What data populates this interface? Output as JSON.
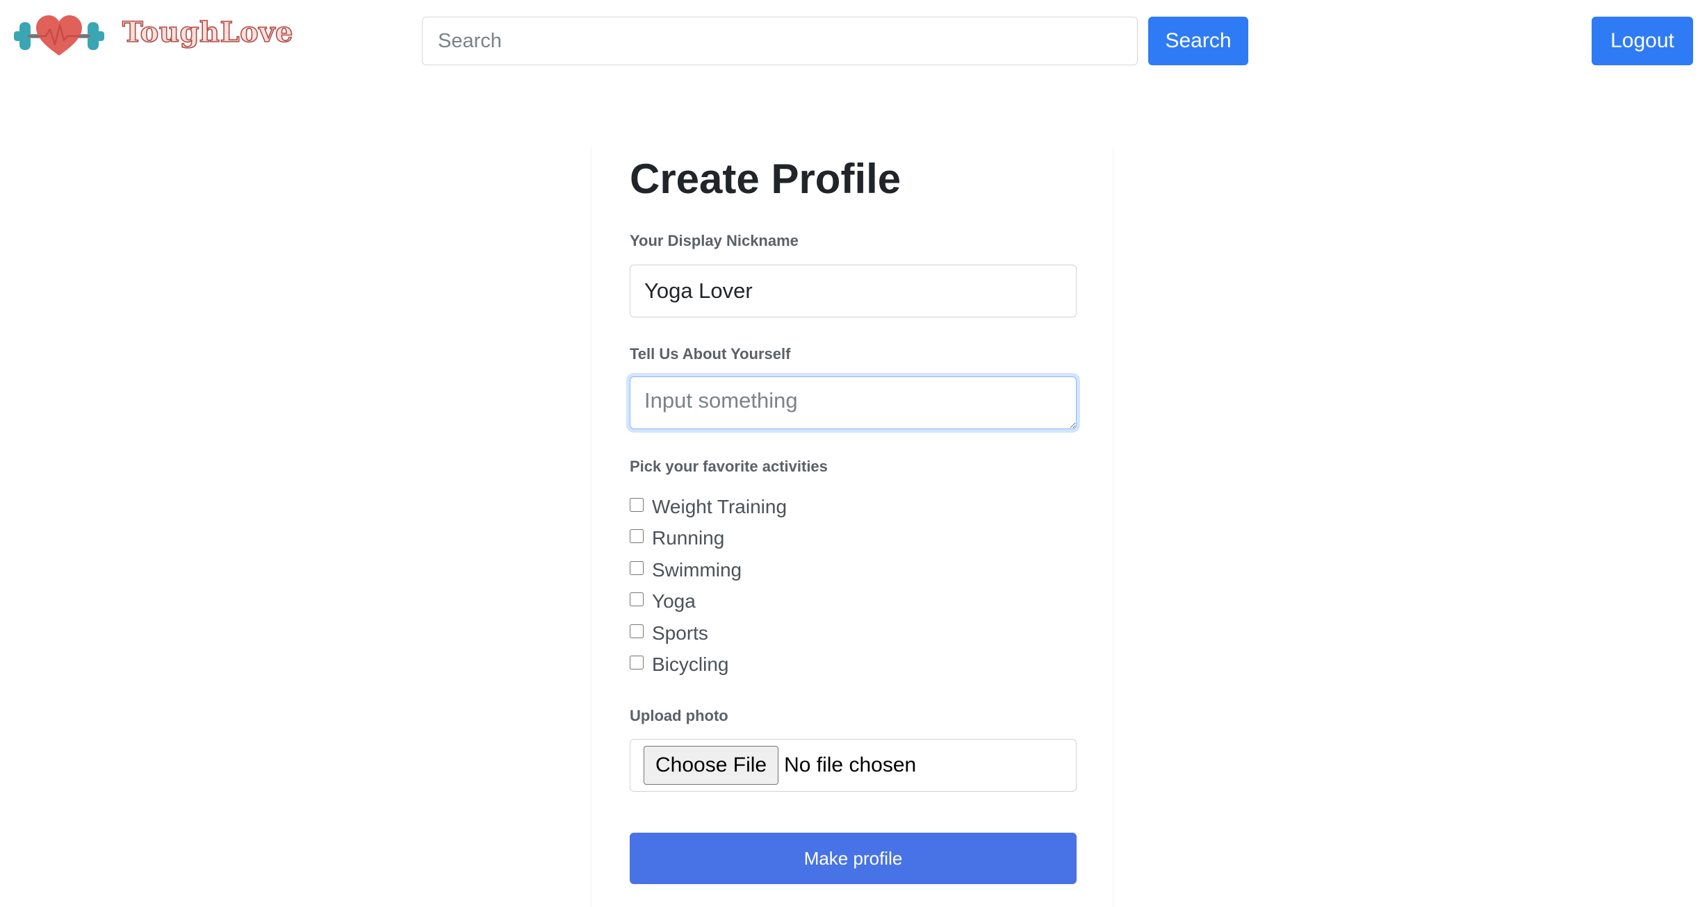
{
  "navbar": {
    "brand_name": "ToughLove",
    "search": {
      "placeholder": "Search",
      "value": ""
    },
    "search_button": "Search",
    "logout_button": "Logout"
  },
  "form": {
    "title": "Create Profile",
    "nickname": {
      "label": "Your Display Nickname",
      "value": "Yoga Lover"
    },
    "about": {
      "label": "Tell Us About Yourself",
      "placeholder": "Input something",
      "value": ""
    },
    "activities": {
      "label": "Pick your favorite activities",
      "items": [
        {
          "label": "Weight Training",
          "checked": false
        },
        {
          "label": "Running",
          "checked": false
        },
        {
          "label": "Swimming",
          "checked": false
        },
        {
          "label": "Yoga",
          "checked": false
        },
        {
          "label": "Sports",
          "checked": false
        },
        {
          "label": "Bicycling",
          "checked": false
        }
      ]
    },
    "photo": {
      "label": "Upload photo",
      "button": "Choose File",
      "status": "No file chosen"
    },
    "submit": "Make profile"
  },
  "colors": {
    "primary_button": "#2f7bf5",
    "submit_button": "#4873e6",
    "logo_heart": "#e0605a",
    "logo_weights": "#3aa6b4",
    "focus_border": "#86b7fe"
  },
  "icons": {
    "logo": "heart-dumbbell-logo-icon"
  }
}
